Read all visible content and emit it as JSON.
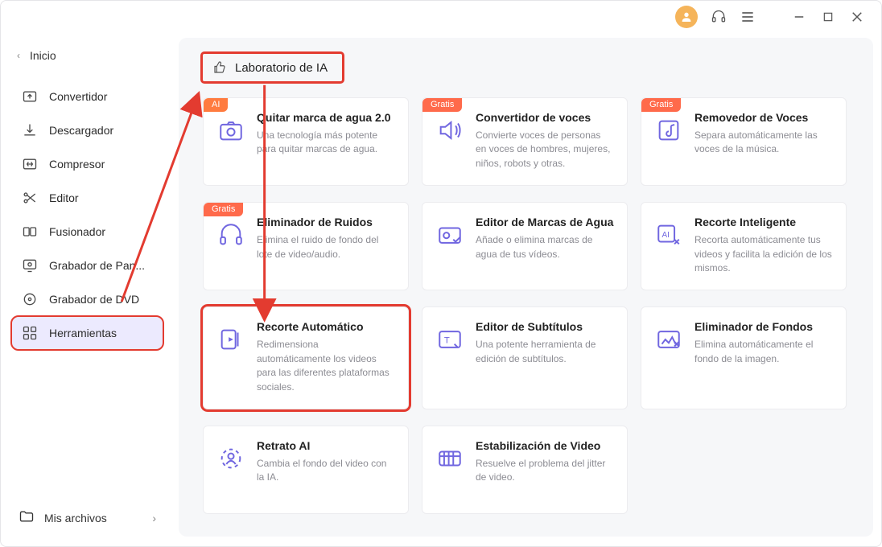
{
  "titlebar": {
    "avatar_initial": ""
  },
  "sidebar": {
    "home_label": "Inicio",
    "items": [
      {
        "label": "Convertidor"
      },
      {
        "label": "Descargador"
      },
      {
        "label": "Compresor"
      },
      {
        "label": "Editor"
      },
      {
        "label": "Fusionador"
      },
      {
        "label": "Grabador de Pan..."
      },
      {
        "label": "Grabador de DVD"
      },
      {
        "label": "Herramientas"
      }
    ],
    "footer_label": "Mis archivos"
  },
  "section": {
    "title": "Laboratorio de IA"
  },
  "cards": [
    {
      "badge": "AI",
      "title": "Quitar marca de agua 2.0",
      "desc": "Una tecnología más potente para quitar marcas de agua."
    },
    {
      "badge": "Gratis",
      "title": "Convertidor de voces",
      "desc": "Convierte voces de personas en voces de hombres, mujeres, niños, robots y otras."
    },
    {
      "badge": "Gratis",
      "title": "Removedor de Voces",
      "desc": "Separa automáticamente las voces de la música."
    },
    {
      "badge": "Gratis",
      "title": "Eliminador de Ruidos",
      "desc": "Elimina el ruido de fondo del lote de video/audio."
    },
    {
      "badge": null,
      "title": "Editor de Marcas de Agua",
      "desc": "Añade o elimina marcas de agua de tus vídeos."
    },
    {
      "badge": null,
      "title": "Recorte Inteligente",
      "desc": "Recorta automáticamente tus videos y facilita la edición de los mismos."
    },
    {
      "badge": null,
      "title": "Recorte Automático",
      "desc": "Redimensiona automáticamente los videos para las diferentes plataformas sociales."
    },
    {
      "badge": null,
      "title": "Editor de Subtítulos",
      "desc": "Una potente herramienta de edición de subtítulos."
    },
    {
      "badge": null,
      "title": "Eliminador de Fondos",
      "desc": "Elimina automáticamente el fondo de la imagen."
    },
    {
      "badge": null,
      "title": "Retrato AI",
      "desc": "Cambia el fondo del video con la IA."
    },
    {
      "badge": null,
      "title": "Estabilización de Video",
      "desc": "Resuelve el problema del jitter de video."
    }
  ]
}
